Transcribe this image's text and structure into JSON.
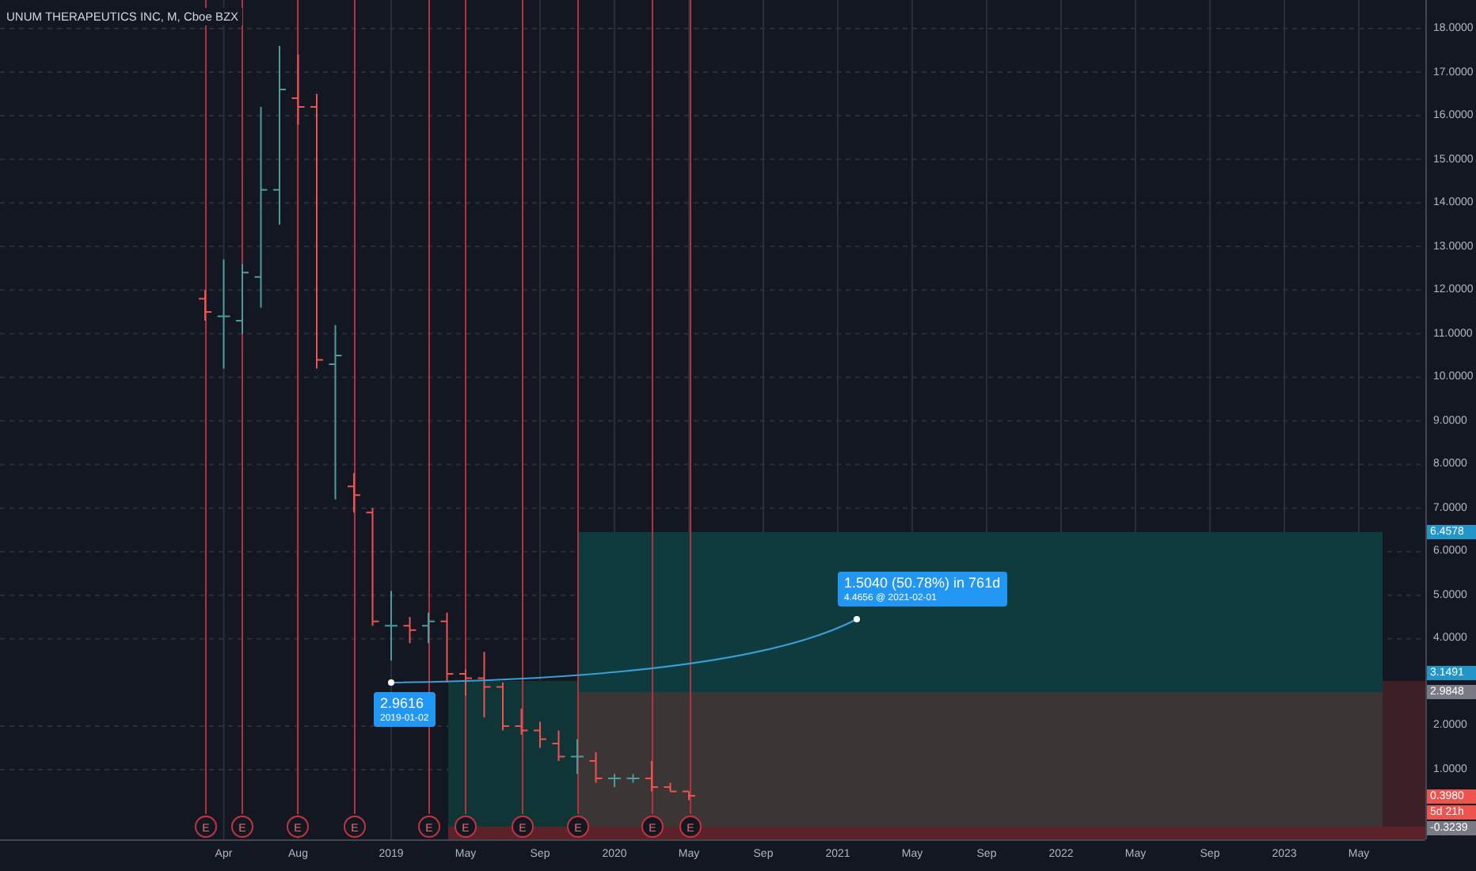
{
  "chart": {
    "title": "UNUM THERAPEUTICS INC, M, Cboe BZX"
  },
  "earnings_markers": [
    "E",
    "E",
    "E",
    "E",
    "E",
    "E",
    "E",
    "E",
    "E",
    "E"
  ],
  "measure": {
    "start": {
      "price": "2.9616",
      "date": "2019-01-02"
    },
    "end": {
      "change": "1.5040 (50.78%) in 761d",
      "detail": "4.4656 @ 2021-02-01"
    }
  },
  "price_axis": {
    "ticks": [
      "18.0000",
      "17.0000",
      "16.0000",
      "15.0000",
      "14.0000",
      "13.0000",
      "12.0000",
      "11.0000",
      "10.0000",
      "9.0000",
      "8.0000",
      "7.0000",
      "6.0000",
      "5.0000",
      "4.0000",
      "2.0000",
      "1.0000"
    ],
    "tags": [
      {
        "text": "6.4578",
        "color": "#2196c9"
      },
      {
        "text": "3.1491",
        "color": "#2196c9"
      },
      {
        "text": "2.9848",
        "color": "#787b86"
      },
      {
        "text": "0.3980",
        "color": "#ef5350"
      },
      {
        "text": "5d 21h",
        "color": "#ef5350"
      },
      {
        "text": "-0.3239",
        "color": "#787b86"
      }
    ]
  },
  "time_axis": [
    "Apr",
    "Aug",
    "2019",
    "May",
    "Sep",
    "2020",
    "May",
    "Sep",
    "2021",
    "May",
    "Sep",
    "2022",
    "May",
    "Sep",
    "2023",
    "May"
  ]
}
